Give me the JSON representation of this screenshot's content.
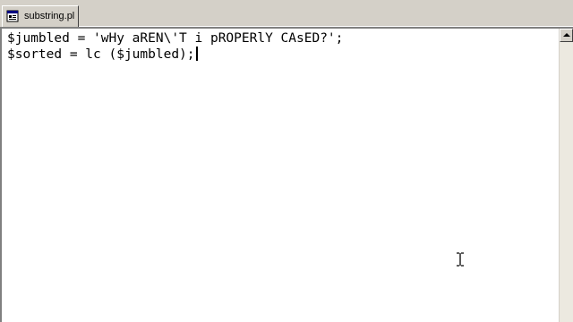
{
  "tab": {
    "label": "substring.pl",
    "icon": "perl-file-icon"
  },
  "editor": {
    "lines": [
      "$jumbled = 'wHy aREN\\'T i pROPERlY CAsED?';",
      "$sorted = lc ($jumbled);"
    ]
  },
  "colors": {
    "chrome": "#d4d0c8",
    "editor_bg": "#ffffff",
    "text": "#000000"
  }
}
